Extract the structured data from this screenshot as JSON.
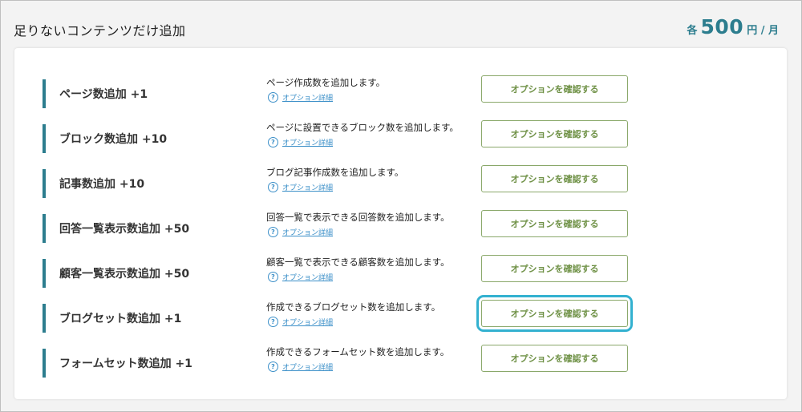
{
  "header": {
    "title": "足りないコンテンツだけ追加",
    "price_prefix": "各",
    "price_amount": "500",
    "price_unit": "円 / 月"
  },
  "colors": {
    "accent": "#2c7d8e",
    "button_border": "#8aa86a",
    "button_text": "#6f9146",
    "highlight": "#33b1d0",
    "link": "#3b8fc8"
  },
  "options": [
    {
      "name": "ページ数追加 +1",
      "description": "ページ作成数を追加します。",
      "detail_label": "オプション詳細",
      "button_label": "オプションを確認する",
      "highlighted": false
    },
    {
      "name": "ブロック数追加 +10",
      "description": "ページに設置できるブロック数を追加します。",
      "detail_label": "オプション詳細",
      "button_label": "オプションを確認する",
      "highlighted": false
    },
    {
      "name": "記事数追加 +10",
      "description": "ブログ記事作成数を追加します。",
      "detail_label": "オプション詳細",
      "button_label": "オプションを確認する",
      "highlighted": false
    },
    {
      "name": "回答一覧表示数追加 +50",
      "description": "回答一覧で表示できる回答数を追加します。",
      "detail_label": "オプション詳細",
      "button_label": "オプションを確認する",
      "highlighted": false
    },
    {
      "name": "顧客一覧表示数追加 +50",
      "description": "顧客一覧で表示できる顧客数を追加します。",
      "detail_label": "オプション詳細",
      "button_label": "オプションを確認する",
      "highlighted": false
    },
    {
      "name": "ブログセット数追加 +1",
      "description": "作成できるブログセット数を追加します。",
      "detail_label": "オプション詳細",
      "button_label": "オプションを確認する",
      "highlighted": true
    },
    {
      "name": "フォームセット数追加 +1",
      "description": "作成できるフォームセット数を追加します。",
      "detail_label": "オプション詳細",
      "button_label": "オプションを確認する",
      "highlighted": false
    }
  ]
}
